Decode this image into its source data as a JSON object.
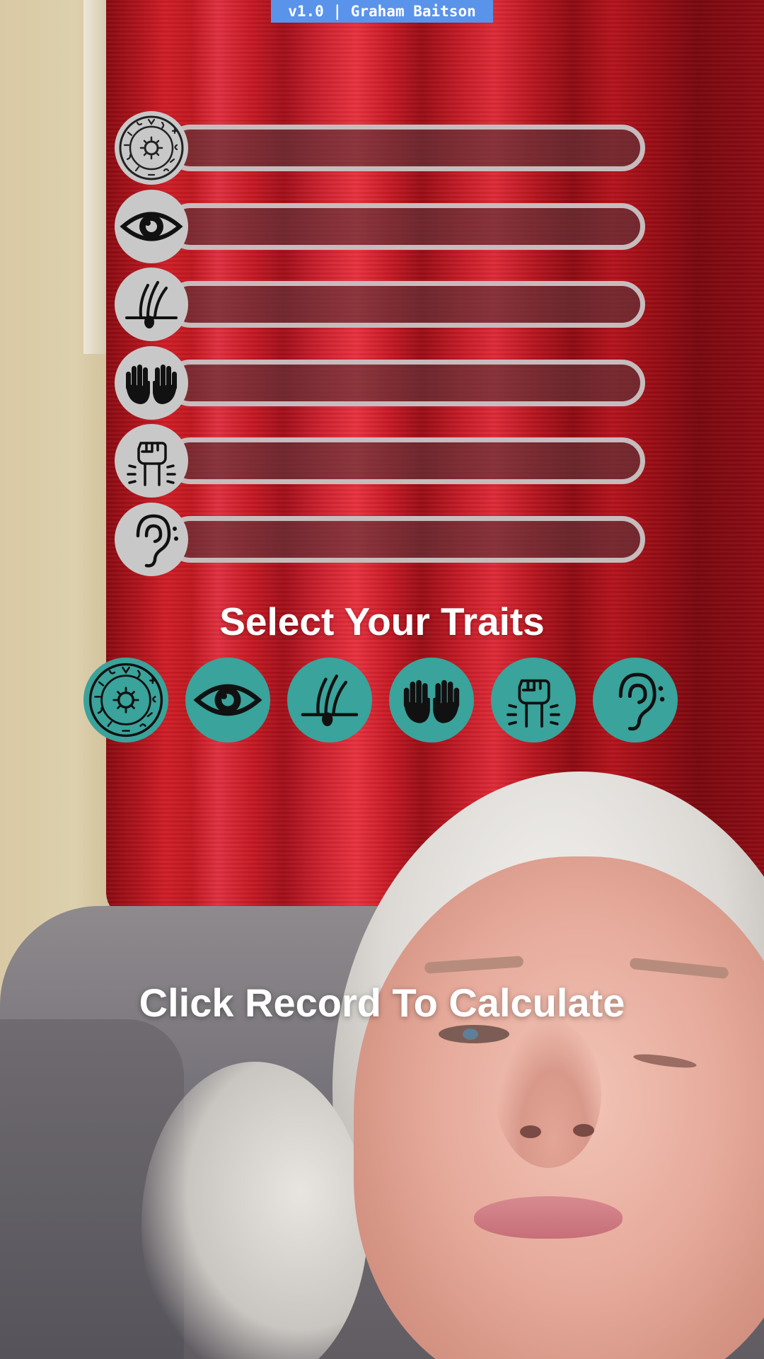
{
  "version_label": "v1.0 | Graham Baitson",
  "traits": [
    {
      "icon": "zodiac-icon",
      "fill": 0
    },
    {
      "icon": "eye-icon",
      "fill": 0
    },
    {
      "icon": "hair-follicle-icon",
      "fill": 0
    },
    {
      "icon": "hands-icon",
      "fill": 0
    },
    {
      "icon": "raised-fist-icon",
      "fill": 0
    },
    {
      "icon": "ear-icon",
      "fill": 0
    }
  ],
  "heading": "Select Your Traits",
  "selector_icons": [
    "zodiac-icon",
    "eye-icon",
    "hair-follicle-icon",
    "hands-icon",
    "raised-fist-icon",
    "ear-icon"
  ],
  "prompt": "Click Record To Calculate",
  "colors": {
    "version_badge": "#5a93ea",
    "trait_icon_bg": "#c8c8c8",
    "selector_bg": "#3aa39b",
    "bar_border": "#c7bcbd",
    "text": "#ffffff"
  }
}
